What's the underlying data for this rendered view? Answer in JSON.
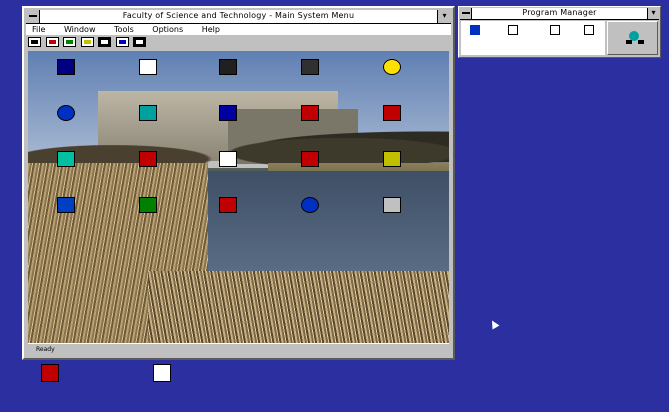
{
  "main_window": {
    "title": "Faculty of Science and Technology - Main System Menu",
    "menu": [
      "File",
      "Window",
      "Tools",
      "Options",
      "Help"
    ],
    "status": "Ready"
  },
  "desktop_icons": [
    {
      "label": "",
      "icon": "terminal-icon",
      "color": "#000080"
    },
    {
      "label": "",
      "icon": "mail-icon",
      "color": "#ffffff"
    },
    {
      "label": "",
      "icon": "graduation-cap-icon",
      "color": "#202020"
    },
    {
      "label": "",
      "icon": "monitor-icon",
      "color": "#303030"
    },
    {
      "label": "",
      "icon": "smiley-icon",
      "color": "#ffe000"
    },
    {
      "label": "",
      "icon": "info-icon",
      "color": "#0030c0"
    },
    {
      "label": "",
      "icon": "calendar-icon",
      "color": "#00a0a0"
    },
    {
      "label": "",
      "icon": "keyboard-icon",
      "color": "#0000a0"
    },
    {
      "label": "",
      "icon": "presentation-icon",
      "color": "#c00000"
    },
    {
      "label": "",
      "icon": "folder-icon",
      "color": "#c00000"
    },
    {
      "label": "",
      "icon": "network-icon",
      "color": "#00c0a0"
    },
    {
      "label": "",
      "icon": "bag-icon",
      "color": "#c00000"
    },
    {
      "label": "",
      "icon": "document-icon",
      "color": "#ffffff"
    },
    {
      "label": "",
      "icon": "printer-icon",
      "color": "#c00000"
    },
    {
      "label": "",
      "icon": "chart-icon",
      "color": "#c0c000"
    },
    {
      "label": "",
      "icon": "group-icon",
      "color": "#0040c0"
    },
    {
      "label": "",
      "icon": "clipboard-icon",
      "color": "#008000"
    },
    {
      "label": "",
      "icon": "people-icon",
      "color": "#c00000"
    },
    {
      "label": "",
      "icon": "info-icon",
      "color": "#0030c0"
    },
    {
      "label": "",
      "icon": "computer-icon",
      "color": "#c0c0c0"
    }
  ],
  "side_window": {
    "title": "Program Manager",
    "items": [
      "",
      "",
      "",
      ""
    ],
    "status": ""
  },
  "bottom_icons": [
    {
      "label": "",
      "icon": "puzzle-icon"
    },
    {
      "label": "",
      "icon": "computer-icon"
    }
  ]
}
